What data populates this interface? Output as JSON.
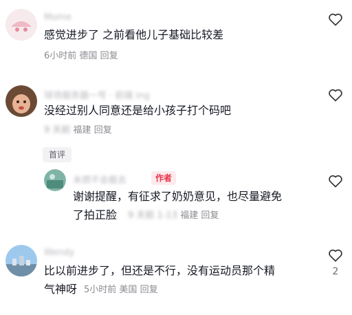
{
  "comments": [
    {
      "username": "Mome",
      "text": "感觉进步了 之前看他儿子基础比较差",
      "time": "6小时前",
      "location": "德国",
      "reply_label": "回复",
      "likes": ""
    },
    {
      "username": "球场服务器一号 · 前端 ing",
      "text": "没经过别人同意还是给小孩子打个码吧",
      "time": "9 天前",
      "location": "福建",
      "reply_label": "回复",
      "likes": ""
    },
    {
      "username": "Wendy",
      "text_line1": "比以前进步了，但还是不行，没有运动员那个精",
      "text_line2": "气神呀",
      "time": "5小时前",
      "location": "美国",
      "reply_label": "回复",
      "likes": "2"
    }
  ],
  "first_comment_tag": "首评",
  "reply": {
    "username": "未燃不会截去",
    "badge": "作者",
    "text_line1": "谢谢提醒，有征求了奶奶意见，也尽量避免",
    "text_line2": "了拍正脸",
    "time": "9 天前 1-13",
    "location": "福建",
    "reply_label": "回复"
  },
  "icons": {
    "like": "heart-outline-icon"
  }
}
